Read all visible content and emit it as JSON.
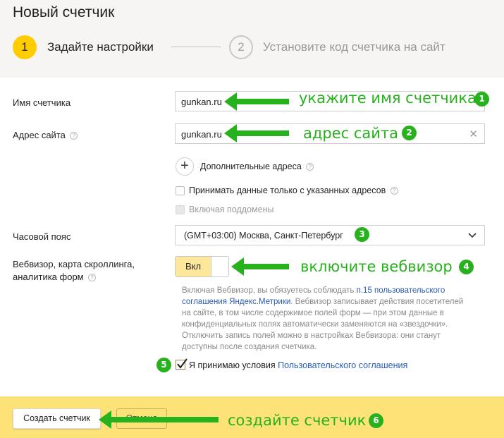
{
  "header": {
    "title": "Новый счетчик",
    "steps": [
      {
        "number": "1",
        "label": "Задайте настройки"
      },
      {
        "number": "2",
        "label": "Установите код счетчика на сайт"
      }
    ]
  },
  "form": {
    "counter_name": {
      "label": "Имя счетчика",
      "value": "gunkan.ru"
    },
    "site_address": {
      "label": "Адрес сайта",
      "value": "gunkan.ru"
    },
    "help_glyph": "?",
    "clear_glyph": "✕",
    "add_glyph": "+",
    "additional_addresses_label": "Дополнительные адреса",
    "only_listed_label": "Принимать данные только с указанных адресов",
    "subdomains_label": "Включая поддомены",
    "timezone": {
      "label": "Часовой пояс",
      "value": "(GMT+03:00) Москва, Санкт-Петербург"
    },
    "webvisor": {
      "label_line1": "Вебвизор, карта скроллинга,",
      "label_line2": "аналитика форм",
      "toggle_label": "Вкл",
      "toggle_on": true
    },
    "note": {
      "part1": "Включая Вебвизор, вы обязуетесь соблюдать ",
      "link": "п.15 пользовательского соглашения Яндекс.Метрики",
      "part2": ". Вебвизор записывает действия посетителей на сайте, в том числе содержимое полей форм — при этом данные в конфиденциальных полях автоматически заменяются на «звездочки». Отключить запись полей можно в настройках Вебвизора: они станут доступны после создания счетчика."
    },
    "agree": {
      "text": "Я принимаю условия ",
      "link": "Пользовательского соглашения",
      "checked": true
    }
  },
  "footer": {
    "create_label": "Создать счетчик",
    "cancel_label": "Отмена"
  },
  "annotations": {
    "a1": {
      "text": "укажите имя счетчика",
      "badge": "1"
    },
    "a2": {
      "text": "адрес сайта",
      "badge": "2"
    },
    "a3": {
      "badge": "3"
    },
    "a4": {
      "text": "включите вебвизор",
      "badge": "4"
    },
    "a5": {
      "badge": "5"
    },
    "a6": {
      "text": "создайте счетчик",
      "badge": "6"
    }
  },
  "colors": {
    "accent": "#ffcc00",
    "annotation_green": "#27b11c",
    "footer_bg": "#fde278",
    "link": "#2a5bb8"
  }
}
